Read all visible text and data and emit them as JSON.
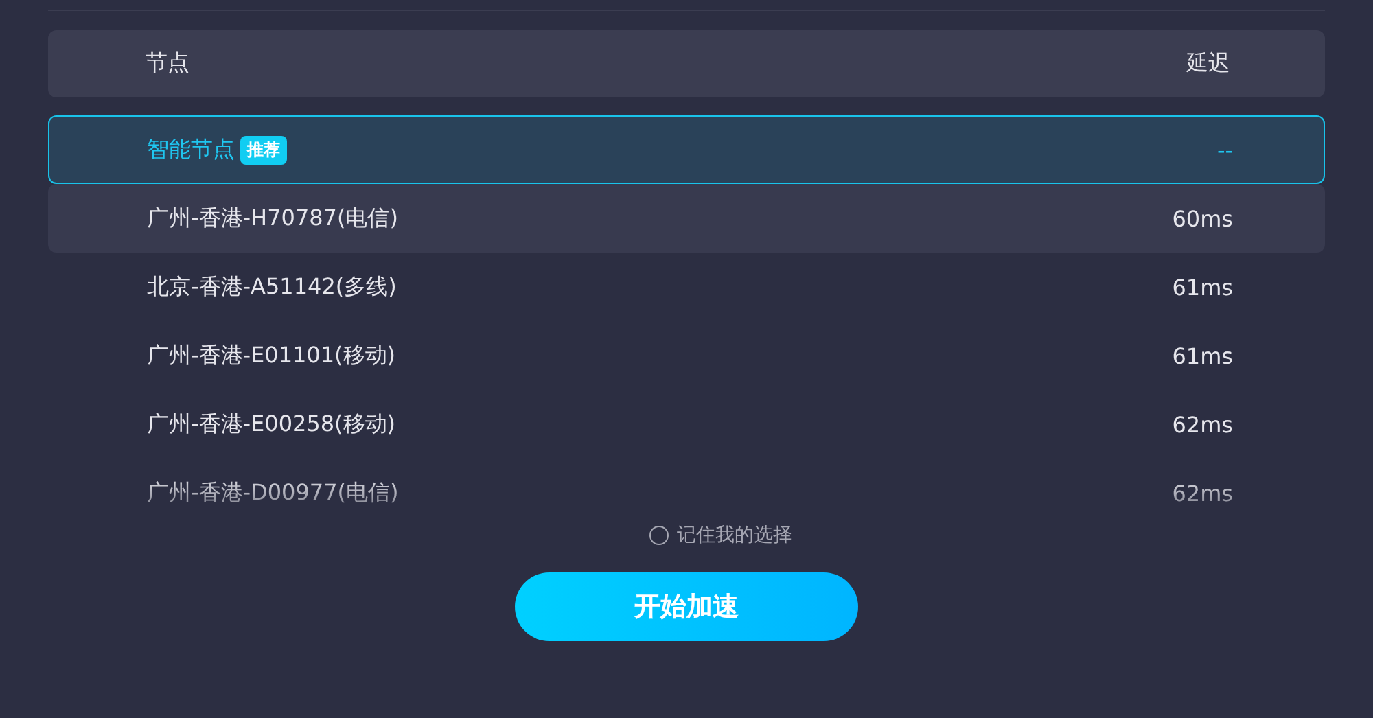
{
  "table": {
    "columns": [
      "节点",
      "延迟"
    ],
    "rows": [
      {
        "name": "智能节点",
        "badge": "推荐",
        "latency": "--",
        "selected": true,
        "hovered": false
      },
      {
        "name": "广州-香港-H70787(电信)",
        "latency": "60ms",
        "selected": false,
        "hovered": true
      },
      {
        "name": "北京-香港-A51142(多线)",
        "latency": "61ms",
        "selected": false,
        "hovered": false
      },
      {
        "name": "广州-香港-E01101(移动)",
        "latency": "61ms",
        "selected": false,
        "hovered": false
      },
      {
        "name": "广州-香港-E00258(移动)",
        "latency": "62ms",
        "selected": false,
        "hovered": false
      },
      {
        "name": "广州-香港-D00977(电信)",
        "latency": "62ms",
        "selected": false,
        "hovered": false
      }
    ]
  },
  "remember": {
    "label": "记住我的选择",
    "checked": false
  },
  "start_button": "开始加速"
}
